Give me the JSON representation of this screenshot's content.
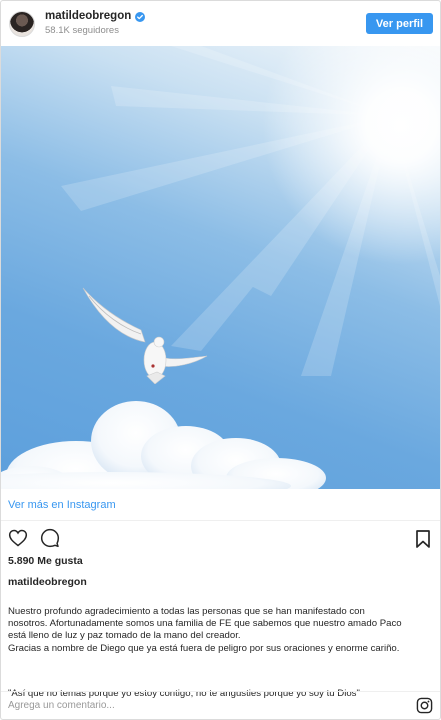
{
  "header": {
    "username": "matildeobregon",
    "followers": "58.1K seguidores",
    "profile_button": "Ver perfil"
  },
  "post": {
    "image_icon": "dove-in-sky-photo",
    "view_more": "Ver más en Instagram",
    "likes": "5.890 Me gusta",
    "author": "matildeobregon",
    "caption_lines": [
      "Nuestro profundo agradecimiento a todas las personas que se han manifestado con",
      "nosotros. Afortunadamente somos una familia de FE que sabemos que nuestro amado Paco",
      "está lleno de luz y paz tomado de la mano del creador.",
      "Gracias a nombre de Diego que ya está fuera de peligro por sus oraciones y enorme cariño."
    ],
    "quote": "\"Así que no temas porque yo estoy contigo, no te angusties porque yo soy tu Dios\""
  },
  "comment": {
    "placeholder": "Agrega un comentario..."
  },
  "colors": {
    "accent": "#3897f0",
    "text": "#262626",
    "muted": "#8e8e8e"
  }
}
